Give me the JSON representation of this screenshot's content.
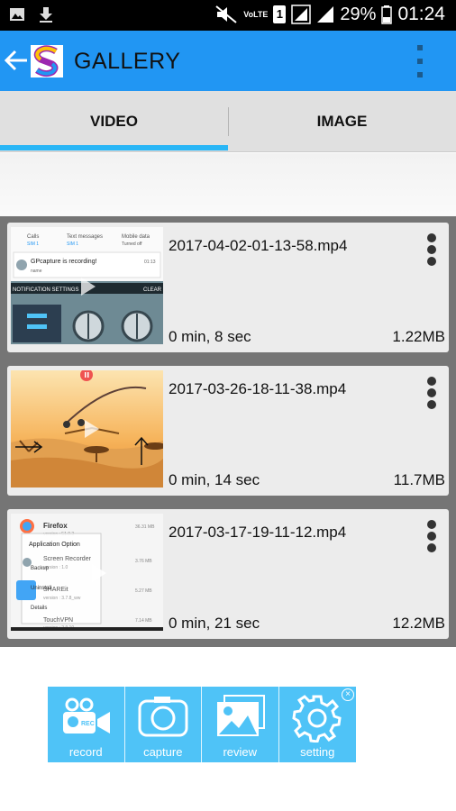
{
  "status_bar": {
    "carrier_label": "VoLTE",
    "sim_label": "1",
    "battery": "29%",
    "time": "01:24"
  },
  "app_bar": {
    "title": "GALLERY"
  },
  "tabs": [
    {
      "label": "VIDEO",
      "selected": true
    },
    {
      "label": "IMAGE",
      "selected": false
    }
  ],
  "videos": [
    {
      "name": "2017-04-02-01-13-58.mp4",
      "duration": "0 min, 8 sec",
      "size": "1.22MB"
    },
    {
      "name": "2017-03-26-18-11-38.mp4",
      "duration": "0 min, 14 sec",
      "size": "11.7MB"
    },
    {
      "name": "2017-03-17-19-11-12.mp4",
      "duration": "0 min, 21 sec",
      "size": "12.2MB"
    }
  ],
  "thumb1": {
    "calls": "Calls",
    "calls_sim": "SIM 1",
    "texts": "Text messages",
    "texts_sim": "SIM 1",
    "data": "Mobile data",
    "data_state": "Turned off",
    "notif_title": "GPcapture is recording!",
    "notif_sub": "name",
    "notif_time": "01:13",
    "settings": "NOTIFICATION SETTINGS",
    "clear": "CLEAR"
  },
  "thumb3": {
    "firefox": "Firefox",
    "firefox_size": "36.31 MB",
    "app_option": "Application Option",
    "recorder": "Screen Recorder",
    "recorder_ver": "version : 1.0",
    "backup": "Backup",
    "shareit": "SHAREit",
    "shareit_ver": "version : 3.7.8_ww",
    "uninstall": "Uninstall",
    "details": "Details",
    "vpn": "TouchVPN",
    "vpn_ver": "version : 2.9.10",
    "ver1": "version : 51.0.3",
    "size2": "3.76 MB",
    "size3": "5.27 MB",
    "size4": "7.14 MB"
  },
  "float_bar": {
    "record": "record",
    "capture": "capture",
    "review": "review",
    "setting": "setting",
    "rec_badge": "REC",
    "close": "×"
  },
  "colors": {
    "app_bar": "#2196f3",
    "tab_indicator": "#29b6f6",
    "float_bar": "#4fc3f7",
    "list_bg": "#757575",
    "card_bg": "#ececec"
  }
}
